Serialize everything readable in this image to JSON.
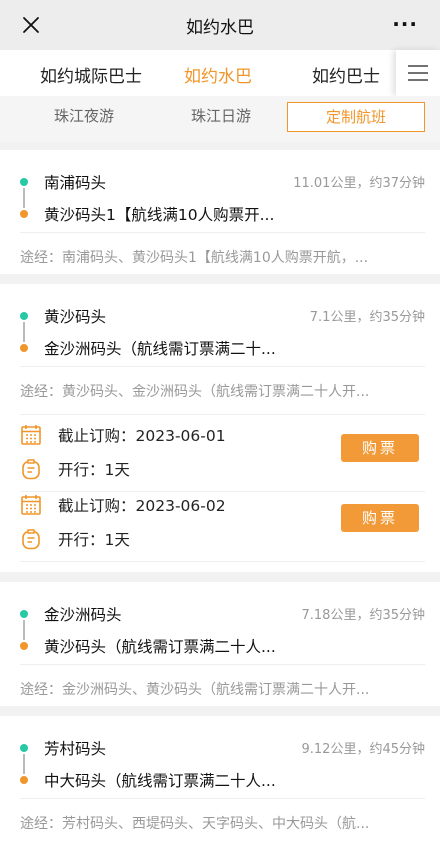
{
  "navbar": {
    "title": "如约水巴",
    "more": "···"
  },
  "tabs": [
    {
      "label": "如约城际巴士",
      "active": false
    },
    {
      "label": "如约水巴",
      "active": true
    },
    {
      "label": "如约巴士",
      "active": false
    }
  ],
  "subtabs": [
    {
      "label": "珠江夜游",
      "active": false
    },
    {
      "label": "珠江日游",
      "active": false
    },
    {
      "label": "定制航班",
      "active": true
    }
  ],
  "colors": {
    "accent": "#f0962a",
    "origin_dot": "#26c9a3",
    "button": "#f29a37"
  },
  "routes": [
    {
      "from": "南浦码头",
      "to": "黄沙码头1【航线满10人购票开...",
      "distance": "11.01公里，约37分钟",
      "via": "途经：南浦码头、黄沙码头1【航线满10人购票开航，..."
    },
    {
      "from": "黄沙码头",
      "to": "金沙洲码头（航线需订票满二十...",
      "distance": "7.1公里，约35分钟",
      "via": "途经：黄沙码头、金沙洲码头（航线需订票满二十人开...",
      "schedules": [
        {
          "deadline": "截止订购：2023-06-01",
          "duration": "开行：1天",
          "button": "购票"
        },
        {
          "deadline": "截止订购：2023-06-02",
          "duration": "开行：1天",
          "button": "购票"
        }
      ]
    },
    {
      "from": "金沙洲码头",
      "to": "黄沙码头（航线需订票满二十人...",
      "distance": "7.18公里，约35分钟",
      "via": "途经：金沙洲码头、黄沙码头（航线需订票满二十人开..."
    },
    {
      "from": "芳村码头",
      "to": "中大码头（航线需订票满二十人...",
      "distance": "9.12公里，约45分钟",
      "via": "途经：芳村码头、西堤码头、天字码头、中大码头（航..."
    }
  ]
}
